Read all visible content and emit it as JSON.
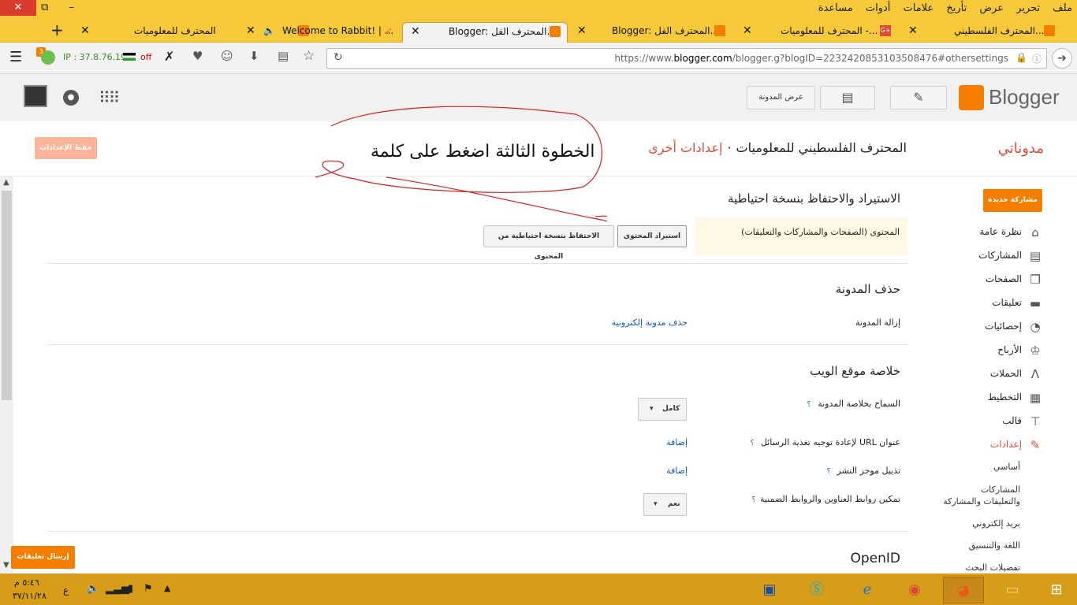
{
  "window": {
    "close_glyph": "✕",
    "restore_glyph": "⧉",
    "minimize_glyph": "–",
    "menus": [
      "ملف",
      "تحرير",
      "عرض",
      "تأريخ",
      "علامات",
      "أدوات",
      "مساعدة"
    ]
  },
  "tabs": [
    {
      "title": "المحترف الفلسطيني...",
      "active": false
    },
    {
      "title": "المحترف للمعلوميات -...",
      "active": false
    },
    {
      "title": "Blogger: المحترف الفل...",
      "active": false
    },
    {
      "title": "Blogger: المحترف الفل...",
      "active": true
    },
    {
      "title": "Welcome to Rabbit! | ...",
      "active": false
    },
    {
      "title": "المحترف للمعلوميات",
      "active": false
    }
  ],
  "new_tab": "+",
  "toolbar": {
    "badge_count": "3",
    "ip": "IP : 37.8.76.19",
    "off_label": "off",
    "url_prefix": "https://www.",
    "url_domain": "blogger.com",
    "url_path": "/blogger.g?blogID=2232420853103508476#othersettings"
  },
  "blogger_header": {
    "logo_text": "Blogger",
    "view_blog": "عرض المدونة"
  },
  "titlebar": {
    "my_blogs": "مدوناتي",
    "blog_name": "المحترف الفلسطيني للمعلوميات",
    "separator": "·",
    "current_page": "إعدادات أخرى",
    "save_settings": "حفظ الإعدادات"
  },
  "annotation": "الخطوة الثالثة اضغط على كلمة",
  "sidebar": {
    "new_post": "مشاركة جديدة",
    "items": [
      {
        "label": "نظرة عامة",
        "icon": "home-icon",
        "glyph": "⌂"
      },
      {
        "label": "المشاركات",
        "icon": "posts-icon",
        "glyph": "▤"
      },
      {
        "label": "الصفحات",
        "icon": "pages-icon",
        "glyph": "❐"
      },
      {
        "label": "تعليقات",
        "icon": "comments-icon",
        "glyph": "▬"
      },
      {
        "label": "إحصائيات",
        "icon": "stats-icon",
        "glyph": "◔"
      },
      {
        "label": "الأرباح",
        "icon": "trophy-icon",
        "glyph": "♔"
      },
      {
        "label": "الحملات",
        "icon": "campaigns-icon",
        "glyph": "Ʌ"
      },
      {
        "label": "التخطيط",
        "icon": "layout-icon",
        "glyph": "▦"
      },
      {
        "label": "قالب",
        "icon": "template-icon",
        "glyph": "⊤"
      },
      {
        "label": "إعدادات",
        "icon": "settings-wrench-icon",
        "glyph": "✎"
      }
    ],
    "subitems": [
      "أساسي",
      "المشاركات والتعليقات والمشاركة",
      "بريد إلكتروني",
      "اللغة والتنسيق",
      "تفضيلات البحث"
    ]
  },
  "sections": {
    "import_backup": {
      "title": "الاستيراد والاحتفاظ بنسخة احتياطية",
      "content_label": "المحتوى (الصفحات والمشاركات والتعليقات)",
      "import_button": "استيراد المحتوى",
      "backup_button": "الاحتفاظ بنسخة احتياطية من المحتوى"
    },
    "delete_blog": {
      "title": "حذف المدونة",
      "remove_label": "إزالة المدونة",
      "delete_link": "حذف مدونة إلكترونية"
    },
    "site_feed": {
      "title": "خلاصة موقع الويب",
      "allow_feed_label": "السماح بخلاصة المدونة",
      "allow_feed_value": "كامل",
      "redirect_label": "عنوان URL لإعادة توجيه تغذية الرسائل",
      "redirect_action": "إضافة",
      "footer_label": "تذييل موجز النشر",
      "footer_action": "إضافة",
      "enclosure_label": "تمكين روابط العناوين والروابط الضمنية",
      "enclosure_value": "نعم",
      "help": "؟"
    },
    "openid": {
      "title": "OpenID"
    }
  },
  "feedback_button": "إرسال تعليقات",
  "taskbar": {
    "time": "٥:٤٦ م",
    "date": "٣٧/١١/٢٨",
    "lang": "ع"
  },
  "colors": {
    "accent": "#f57d00",
    "title_red": "#dd4b39",
    "link": "#1155cc",
    "firefox_bar": "#f6c93a",
    "taskbar": "#d79d18"
  }
}
